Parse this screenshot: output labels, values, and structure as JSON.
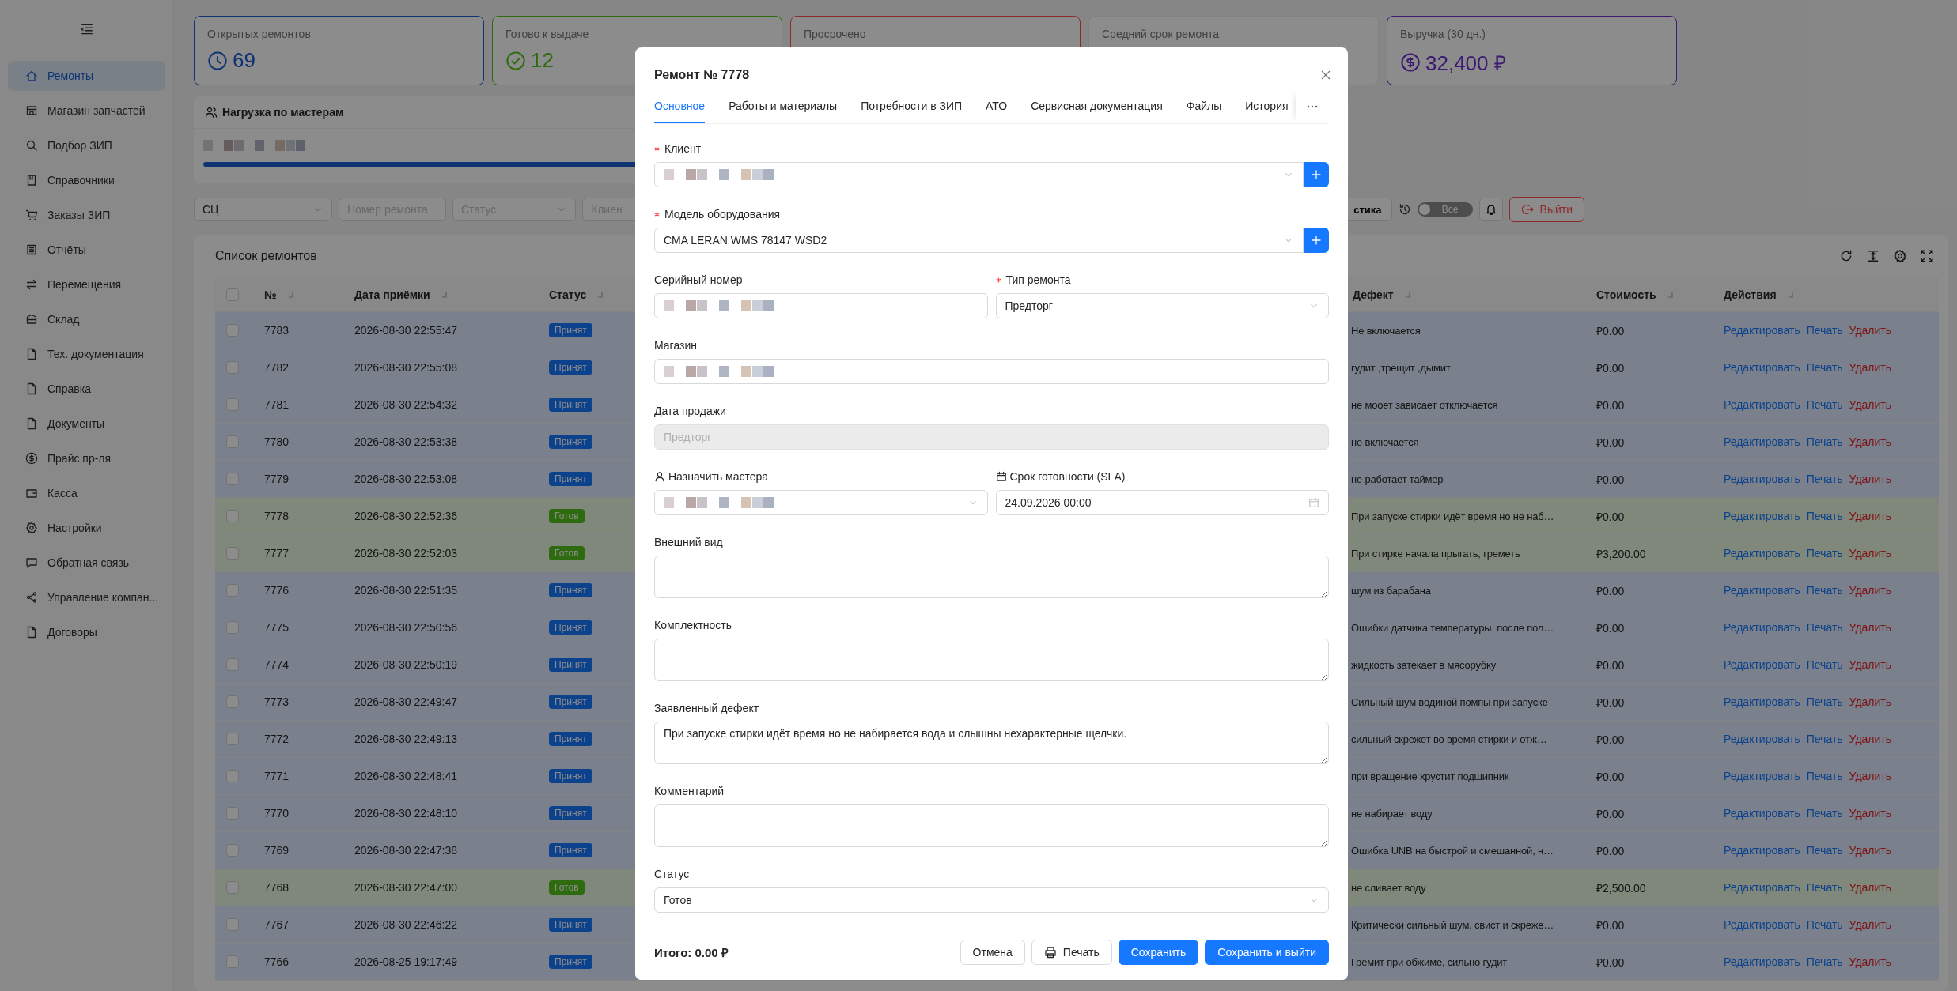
{
  "sidebar": {
    "items": [
      {
        "label": "Ремонты",
        "selected": true
      },
      {
        "label": "Магазин запчастей",
        "selected": false
      },
      {
        "label": "Подбор ЗИП",
        "selected": false
      },
      {
        "label": "Справочники",
        "selected": false
      },
      {
        "label": "Заказы ЗИП",
        "selected": false
      },
      {
        "label": "Отчёты",
        "selected": false
      },
      {
        "label": "Перемещения",
        "selected": false
      },
      {
        "label": "Склад",
        "selected": false
      },
      {
        "label": "Тех. документация",
        "selected": false
      },
      {
        "label": "Справка",
        "selected": false
      },
      {
        "label": "Документы",
        "selected": false
      },
      {
        "label": "Прайс пр-ля",
        "selected": false
      },
      {
        "label": "Касса",
        "selected": false
      },
      {
        "label": "Настройки",
        "selected": false
      },
      {
        "label": "Обратная связь",
        "selected": false
      },
      {
        "label": "Управление компан...",
        "selected": false
      },
      {
        "label": "Договоры",
        "selected": false
      }
    ]
  },
  "stats": [
    {
      "kind": "open",
      "label": "Открытых ремонтов",
      "value": "69"
    },
    {
      "kind": "ready",
      "label": "Готово к выдаче",
      "value": "12"
    },
    {
      "kind": "overdue",
      "label": "Просрочено"
    },
    {
      "kind": "average",
      "label": "Средний срок ремонта"
    },
    {
      "kind": "revenue",
      "label": "Выручка (30 дн.)",
      "value": "32,400 ₽"
    }
  ],
  "workload": {
    "title": "Нагрузка по мастерам",
    "bars": [
      {
        "level": 1
      }
    ]
  },
  "filters": {
    "items": [
      {
        "kind": "select",
        "value": "СЦ"
      },
      {
        "kind": "input",
        "placeholder": "Номер ремонта"
      },
      {
        "kind": "select",
        "placeholder": "Статус"
      },
      {
        "kind": "input",
        "placeholder": "Клиен"
      }
    ],
    "tools": [
      {
        "kind": "button",
        "label": "стика"
      },
      {
        "kind": "history"
      },
      {
        "kind": "switch",
        "label": "Все",
        "on": false
      },
      {
        "kind": "bell"
      },
      {
        "kind": "logout",
        "label": "Выйти"
      }
    ]
  },
  "table": {
    "title": "Список ремонтов",
    "header_checked": false,
    "columns": [
      "№",
      "Дата приёмки",
      "Статус",
      "Дефект",
      "Стоимость",
      "Действия"
    ],
    "rows": [
      {
        "checked": false,
        "number": "7783",
        "date": "2026-08-30 22:55:47",
        "status": {
          "label": "Принят",
          "kind": "accepted"
        },
        "defect": "Не включается",
        "cost": "₽0.00",
        "actions": [
          {
            "label": "Редактировать",
            "kind": "link"
          },
          {
            "label": "Печать",
            "kind": "link"
          },
          {
            "label": "Удалить",
            "kind": "danger"
          }
        ]
      },
      {
        "checked": false,
        "number": "7782",
        "date": "2026-08-30 22:55:08",
        "status": {
          "label": "Принят",
          "kind": "accepted"
        },
        "defect": "гудит ,трещит ,дымит",
        "cost": "₽0.00",
        "actions": [
          {
            "label": "Редактировать",
            "kind": "link"
          },
          {
            "label": "Печать",
            "kind": "link"
          },
          {
            "label": "Удалить",
            "kind": "danger"
          }
        ]
      },
      {
        "checked": false,
        "number": "7781",
        "date": "2026-08-30 22:54:32",
        "status": {
          "label": "Принят",
          "kind": "accepted"
        },
        "defect": "не мооет зависает отключается",
        "cost": "₽0.00",
        "actions": [
          {
            "label": "Редактировать",
            "kind": "link"
          },
          {
            "label": "Печать",
            "kind": "link"
          },
          {
            "label": "Удалить",
            "kind": "danger"
          }
        ]
      },
      {
        "checked": false,
        "number": "7780",
        "date": "2026-08-30 22:53:38",
        "status": {
          "label": "Принят",
          "kind": "accepted"
        },
        "defect": "не включается",
        "cost": "₽0.00",
        "actions": [
          {
            "label": "Редактировать",
            "kind": "link"
          },
          {
            "label": "Печать",
            "kind": "link"
          },
          {
            "label": "Удалить",
            "kind": "danger"
          }
        ]
      },
      {
        "checked": false,
        "number": "7779",
        "date": "2026-08-30 22:53:08",
        "status": {
          "label": "Принят",
          "kind": "accepted"
        },
        "defect": "не работает таймер",
        "cost": "₽0.00",
        "actions": [
          {
            "label": "Редактировать",
            "kind": "link"
          },
          {
            "label": "Печать",
            "kind": "link"
          },
          {
            "label": "Удалить",
            "kind": "danger"
          }
        ]
      },
      {
        "checked": false,
        "number": "7778",
        "date": "2026-08-30 22:52:36",
        "status": {
          "label": "Готов",
          "kind": "ready"
        },
        "defect": "При запуске стирки идёт время но не наб…",
        "cost": "₽0.00",
        "actions": [
          {
            "label": "Редактировать",
            "kind": "link"
          },
          {
            "label": "Печать",
            "kind": "link"
          },
          {
            "label": "Удалить",
            "kind": "danger"
          }
        ]
      },
      {
        "checked": false,
        "number": "7777",
        "date": "2026-08-30 22:52:03",
        "status": {
          "label": "Готов",
          "kind": "ready"
        },
        "defect": "При стирке начала прыгать, греметь",
        "cost": "₽3,200.00",
        "actions": [
          {
            "label": "Редактировать",
            "kind": "link"
          },
          {
            "label": "Печать",
            "kind": "link"
          },
          {
            "label": "Удалить",
            "kind": "danger"
          }
        ]
      },
      {
        "checked": false,
        "number": "7776",
        "date": "2026-08-30 22:51:35",
        "status": {
          "label": "Принят",
          "kind": "accepted"
        },
        "defect": "шум из барабана",
        "cost": "₽0.00",
        "actions": [
          {
            "label": "Редактировать",
            "kind": "link"
          },
          {
            "label": "Печать",
            "kind": "link"
          },
          {
            "label": "Удалить",
            "kind": "danger"
          }
        ]
      },
      {
        "checked": false,
        "number": "7775",
        "date": "2026-08-30 22:50:56",
        "status": {
          "label": "Принят",
          "kind": "accepted"
        },
        "defect": "Ошибки датчика температуры. после пол…",
        "cost": "₽0.00",
        "actions": [
          {
            "label": "Редактировать",
            "kind": "link"
          },
          {
            "label": "Печать",
            "kind": "link"
          },
          {
            "label": "Удалить",
            "kind": "danger"
          }
        ]
      },
      {
        "checked": false,
        "number": "7774",
        "date": "2026-08-30 22:50:19",
        "status": {
          "label": "Принят",
          "kind": "accepted"
        },
        "defect": "жидкость затекает в мясорубку",
        "cost": "₽0.00",
        "actions": [
          {
            "label": "Редактировать",
            "kind": "link"
          },
          {
            "label": "Печать",
            "kind": "link"
          },
          {
            "label": "Удалить",
            "kind": "danger"
          }
        ]
      },
      {
        "checked": false,
        "number": "7773",
        "date": "2026-08-30 22:49:47",
        "status": {
          "label": "Принят",
          "kind": "accepted"
        },
        "defect": "Сильный шум водиной помпы при запуске",
        "cost": "₽0.00",
        "actions": [
          {
            "label": "Редактировать",
            "kind": "link"
          },
          {
            "label": "Печать",
            "kind": "link"
          },
          {
            "label": "Удалить",
            "kind": "danger"
          }
        ]
      },
      {
        "checked": false,
        "number": "7772",
        "date": "2026-08-30 22:49:13",
        "status": {
          "label": "Принят",
          "kind": "accepted"
        },
        "defect": "сильный скрежет во время стирки и отж…",
        "cost": "₽0.00",
        "actions": [
          {
            "label": "Редактировать",
            "kind": "link"
          },
          {
            "label": "Печать",
            "kind": "link"
          },
          {
            "label": "Удалить",
            "kind": "danger"
          }
        ]
      },
      {
        "checked": false,
        "number": "7771",
        "date": "2026-08-30 22:48:41",
        "status": {
          "label": "Принят",
          "kind": "accepted"
        },
        "defect": "при вращение хрустит подшипник",
        "cost": "₽0.00",
        "actions": [
          {
            "label": "Редактировать",
            "kind": "link"
          },
          {
            "label": "Печать",
            "kind": "link"
          },
          {
            "label": "Удалить",
            "kind": "danger"
          }
        ]
      },
      {
        "checked": false,
        "number": "7770",
        "date": "2026-08-30 22:48:10",
        "status": {
          "label": "Принят",
          "kind": "accepted"
        },
        "defect": "не набирает воду",
        "cost": "₽0.00",
        "actions": [
          {
            "label": "Редактировать",
            "kind": "link"
          },
          {
            "label": "Печать",
            "kind": "link"
          },
          {
            "label": "Удалить",
            "kind": "danger"
          }
        ]
      },
      {
        "checked": false,
        "number": "7769",
        "date": "2026-08-30 22:47:38",
        "status": {
          "label": "Принят",
          "kind": "accepted"
        },
        "defect": "Ошибка UNB на быстрой и смешанной, н…",
        "cost": "₽0.00",
        "actions": [
          {
            "label": "Редактировать",
            "kind": "link"
          },
          {
            "label": "Печать",
            "kind": "link"
          },
          {
            "label": "Удалить",
            "kind": "danger"
          }
        ]
      },
      {
        "checked": false,
        "number": "7768",
        "date": "2026-08-30 22:47:00",
        "status": {
          "label": "Готов",
          "kind": "ready"
        },
        "defect": "не сливает воду",
        "cost": "₽2,500.00",
        "actions": [
          {
            "label": "Редактировать",
            "kind": "link"
          },
          {
            "label": "Печать",
            "kind": "link"
          },
          {
            "label": "Удалить",
            "kind": "danger"
          }
        ]
      },
      {
        "checked": false,
        "number": "7767",
        "date": "2026-08-30 22:46:22",
        "status": {
          "label": "Принят",
          "kind": "accepted"
        },
        "defect": "Критически сильный шум, свист и скреже…",
        "cost": "₽0.00",
        "actions": [
          {
            "label": "Редактировать",
            "kind": "link"
          },
          {
            "label": "Печать",
            "kind": "link"
          },
          {
            "label": "Удалить",
            "kind": "danger"
          }
        ]
      },
      {
        "checked": false,
        "number": "7766",
        "date": "2026-08-25 19:17:49",
        "status": {
          "label": "Принят",
          "kind": "accepted"
        },
        "defect": "Гремит при обжиме, сильно гудит",
        "cost": "₽0.00",
        "actions": [
          {
            "label": "Редактировать",
            "kind": "link"
          },
          {
            "label": "Печать",
            "kind": "link"
          },
          {
            "label": "Удалить",
            "kind": "danger"
          }
        ]
      }
    ]
  },
  "modal": {
    "title": "Ремонт № 7778",
    "tabs": [
      {
        "label": "Основное",
        "selected": true
      },
      {
        "label": "Работы и материалы",
        "selected": false
      },
      {
        "label": "Потребности в ЗИП",
        "selected": false
      },
      {
        "label": "АТО",
        "selected": false
      },
      {
        "label": "Сервисная документация",
        "selected": false
      },
      {
        "label": "Файлы",
        "selected": false
      },
      {
        "label": "История",
        "selected": false
      }
    ],
    "rows": [
      [
        {
          "kind": "select-add",
          "label": "Клиент",
          "required": true,
          "blurred": true
        }
      ],
      [
        {
          "kind": "select-add",
          "label": "Модель оборудования",
          "required": true,
          "value": "CMA LERAN WMS 78147 WSD2"
        }
      ],
      [
        {
          "kind": "input",
          "label": "Серийный номер",
          "required": false,
          "blurred": true
        },
        {
          "kind": "select",
          "label": "Тип ремонта",
          "required": true,
          "value": "Предторг"
        }
      ],
      [
        {
          "kind": "input",
          "label": "Магазин",
          "required": false,
          "blurred": true
        }
      ],
      [
        {
          "kind": "input",
          "label": "Дата продажи",
          "required": false,
          "disabled": true,
          "placeholder": "Предторг"
        }
      ],
      [
        {
          "kind": "assignee",
          "label": "Назначить мастера",
          "required": false,
          "blurred": true
        },
        {
          "kind": "date",
          "label": "Срок готовности (SLA)",
          "required": false,
          "value": "24.09.2026 00:00"
        }
      ],
      [
        {
          "kind": "textarea",
          "label": "Внешний вид",
          "required": false
        }
      ],
      [
        {
          "kind": "textarea",
          "label": "Комплектность",
          "required": false
        }
      ],
      [
        {
          "kind": "textarea",
          "label": "Заявленный дефект",
          "required": false,
          "value": "При запуске стирки идёт время но не набирается вода и слышны нехарактерные щелчки."
        }
      ],
      [
        {
          "kind": "textarea",
          "label": "Комментарий",
          "required": false
        }
      ],
      [
        {
          "kind": "select",
          "label": "Статус",
          "required": false,
          "value": "Готов"
        }
      ]
    ],
    "total": "Итого: 0.00 ₽",
    "buttons": [
      {
        "label": "Отмена",
        "kind": "default"
      },
      {
        "label": "Печать",
        "kind": "print"
      },
      {
        "label": "Сохранить",
        "kind": "primary"
      },
      {
        "label": "Сохранить и выйти",
        "kind": "primary"
      }
    ]
  }
}
